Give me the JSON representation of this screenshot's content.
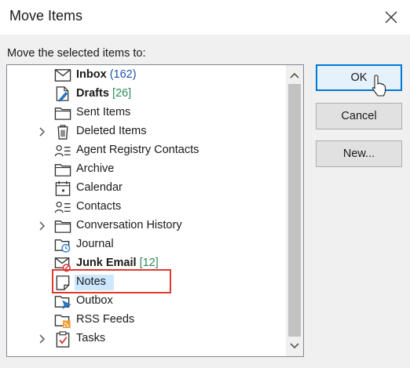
{
  "dialog": {
    "title": "Move Items",
    "prompt": "Move the selected items to:"
  },
  "folders": [
    {
      "name": "Inbox",
      "count": "(162)",
      "bold": true,
      "count_style": "blue",
      "icon": "inbox-icon",
      "expander": false
    },
    {
      "name": "Drafts",
      "count": "[26]",
      "bold": true,
      "count_style": "green",
      "icon": "drafts-icon",
      "expander": false
    },
    {
      "name": "Sent Items",
      "count": "",
      "bold": false,
      "icon": "folder-icon",
      "expander": false
    },
    {
      "name": "Deleted Items",
      "count": "",
      "bold": false,
      "icon": "trash-icon",
      "expander": true
    },
    {
      "name": "Agent Registry Contacts",
      "count": "",
      "bold": false,
      "icon": "contacts-icon",
      "expander": false
    },
    {
      "name": "Archive",
      "count": "",
      "bold": false,
      "icon": "folder-icon",
      "expander": false
    },
    {
      "name": "Calendar",
      "count": "",
      "bold": false,
      "icon": "calendar-icon",
      "expander": false
    },
    {
      "name": "Contacts",
      "count": "",
      "bold": false,
      "icon": "contacts-icon",
      "expander": false
    },
    {
      "name": "Conversation History",
      "count": "",
      "bold": false,
      "icon": "folder-icon",
      "expander": true
    },
    {
      "name": "Journal",
      "count": "",
      "bold": false,
      "icon": "journal-icon",
      "expander": false
    },
    {
      "name": "Junk Email",
      "count": "[12]",
      "bold": true,
      "count_style": "green",
      "icon": "junk-email-icon",
      "expander": false
    },
    {
      "name": "Notes",
      "count": "",
      "bold": false,
      "icon": "notes-icon",
      "expander": false,
      "selected": true
    },
    {
      "name": "Outbox",
      "count": "",
      "bold": false,
      "icon": "outbox-icon",
      "expander": false
    },
    {
      "name": "RSS Feeds",
      "count": "",
      "bold": false,
      "icon": "rss-feeds-icon",
      "expander": false
    },
    {
      "name": "Tasks",
      "count": "",
      "bold": false,
      "icon": "tasks-icon",
      "expander": true
    }
  ],
  "buttons": {
    "ok": "OK",
    "cancel": "Cancel",
    "new": "New..."
  },
  "colors": {
    "accent": "#0078d7",
    "selection": "#cce8ff",
    "highlight_box": "#e03a2e",
    "count_blue": "#1f4fb4",
    "count_green": "#2e8b57"
  }
}
